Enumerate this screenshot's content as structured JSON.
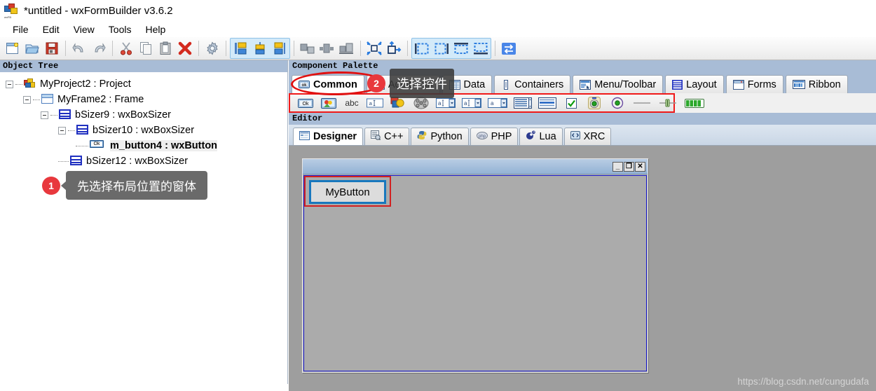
{
  "window": {
    "title": "*untitled - wxFormBuilder v3.6.2",
    "icon": "wxformbuilder-app-icon"
  },
  "menubar": {
    "items": [
      {
        "label": "File"
      },
      {
        "label": "Edit"
      },
      {
        "label": "View"
      },
      {
        "label": "Tools"
      },
      {
        "label": "Help"
      }
    ]
  },
  "toolbar": {
    "groups": [
      {
        "buttons": [
          {
            "name": "new-file-button",
            "icon": "new-document-icon"
          },
          {
            "name": "open-file-button",
            "icon": "open-folder-icon"
          },
          {
            "name": "save-file-button",
            "icon": "floppy-save-icon"
          }
        ]
      },
      {
        "buttons": [
          {
            "name": "undo-button",
            "icon": "undo-arrow-icon"
          },
          {
            "name": "redo-button",
            "icon": "redo-arrow-icon"
          }
        ]
      },
      {
        "buttons": [
          {
            "name": "cut-button",
            "icon": "scissors-icon"
          },
          {
            "name": "copy-button",
            "icon": "copy-icon"
          },
          {
            "name": "paste-button",
            "icon": "clipboard-paste-icon"
          },
          {
            "name": "delete-button",
            "icon": "red-x-delete-icon"
          }
        ]
      },
      {
        "buttons": [
          {
            "name": "generate-code-button",
            "icon": "gear-icon"
          }
        ]
      },
      {
        "buttons": [
          {
            "name": "align-left-button",
            "icon": "panel-left-icon"
          },
          {
            "name": "align-center-button",
            "icon": "panel-center-icon"
          },
          {
            "name": "align-right-button",
            "icon": "panel-right-icon"
          }
        ]
      },
      {
        "buttons": [
          {
            "name": "align-top-button",
            "icon": "align-top-icon"
          },
          {
            "name": "align-middle-button",
            "icon": "align-middle-icon"
          },
          {
            "name": "align-bottom-button",
            "icon": "align-bottom-icon"
          }
        ]
      },
      {
        "buttons": [
          {
            "name": "expand-button",
            "icon": "expand-arrows-icon"
          },
          {
            "name": "stretch-button",
            "icon": "stretch-arrow-icon"
          }
        ]
      },
      {
        "buttons": [
          {
            "name": "border-left-button",
            "icon": "border-left-icon"
          },
          {
            "name": "border-right-button",
            "icon": "border-right-icon"
          },
          {
            "name": "border-top-button",
            "icon": "border-top-icon"
          },
          {
            "name": "border-bottom-button",
            "icon": "border-bottom-icon"
          }
        ]
      },
      {
        "buttons": [
          {
            "name": "swap-orientation-button",
            "icon": "swap-arrows-icon"
          }
        ]
      }
    ]
  },
  "object_tree": {
    "header": "Object Tree",
    "nodes": [
      {
        "label": "MyProject2 : Project",
        "icon": "project-icon",
        "indent": 0,
        "expander": true,
        "selected": false
      },
      {
        "label": "MyFrame2 : Frame",
        "icon": "frame-icon",
        "indent": 1,
        "expander": true,
        "selected": false
      },
      {
        "label": "bSizer9 : wxBoxSizer",
        "icon": "sizer-icon",
        "indent": 2,
        "expander": true,
        "selected": false
      },
      {
        "label": "bSizer10 : wxBoxSizer",
        "icon": "sizer-icon",
        "indent": 3,
        "expander": true,
        "selected": false
      },
      {
        "label": "m_button4 : wxButton",
        "icon": "button-icon",
        "indent": 4,
        "expander": false,
        "selected": true
      },
      {
        "label": "bSizer12 : wxBoxSizer",
        "icon": "sizer-icon",
        "indent": 3,
        "expander": false,
        "selected": false
      }
    ]
  },
  "callouts": [
    {
      "number": "1",
      "text": "先选择布局位置的窗体"
    },
    {
      "number": "2",
      "text": "选择控件"
    }
  ],
  "component_palette": {
    "header": "Component Palette",
    "tabs": [
      {
        "label": "Common",
        "icon": "button-small-icon",
        "active": true
      },
      {
        "label": "Additional",
        "icon": "additional-icon",
        "active": false
      },
      {
        "label": "Data",
        "icon": "grid-data-icon",
        "active": false
      },
      {
        "label": "Containers",
        "icon": "container-icon",
        "active": false
      },
      {
        "label": "Menu/Toolbar",
        "icon": "menu-toolbar-icon",
        "active": false
      },
      {
        "label": "Layout",
        "icon": "layout-sizer-icon",
        "active": false
      },
      {
        "label": "Forms",
        "icon": "form-window-icon",
        "active": false
      },
      {
        "label": "Ribbon",
        "icon": "ribbon-icon",
        "active": false
      }
    ],
    "items": [
      {
        "name": "wxButton",
        "icon": "ok-button-icon"
      },
      {
        "name": "wxBitmapButton",
        "icon": "bitmap-button-icon"
      },
      {
        "name": "wxStaticText",
        "icon": "abc-statictext-icon"
      },
      {
        "name": "wxTextCtrl",
        "icon": "textctrl-icon"
      },
      {
        "name": "wxStaticBitmap",
        "icon": "static-bitmap-icon"
      },
      {
        "name": "wxAnimationCtrl",
        "icon": "film-reel-icon"
      },
      {
        "name": "wxComboBox",
        "icon": "combobox-icon"
      },
      {
        "name": "wxChoice",
        "icon": "choice-icon"
      },
      {
        "name": "wxBitmapCombo",
        "icon": "bitmap-combo-icon"
      },
      {
        "name": "wxListBox",
        "icon": "listbox-icon"
      },
      {
        "name": "wxCheckListBox",
        "icon": "checklistbox-icon"
      },
      {
        "name": "wxCheckBox",
        "icon": "checkbox-icon"
      },
      {
        "name": "wxRadioButton",
        "icon": "radiobutton-sel-icon"
      },
      {
        "name": "wxToggleButton",
        "icon": "radiobutton-icon"
      },
      {
        "name": "wxStaticLine",
        "icon": "staticline-icon"
      },
      {
        "name": "wxSlider",
        "icon": "slider-icon"
      },
      {
        "name": "wxGauge",
        "icon": "gauge-icon"
      }
    ],
    "highlight_color": "#f01a1a"
  },
  "editor": {
    "header": "Editor",
    "tabs": [
      {
        "label": "Designer",
        "icon": "designer-icon",
        "active": true
      },
      {
        "label": "C++",
        "icon": "cpp-icon",
        "active": false
      },
      {
        "label": "Python",
        "icon": "python-icon",
        "active": false
      },
      {
        "label": "PHP",
        "icon": "php-icon",
        "active": false
      },
      {
        "label": "Lua",
        "icon": "lua-icon",
        "active": false
      },
      {
        "label": "XRC",
        "icon": "xrc-icon",
        "active": false
      }
    ]
  },
  "designer": {
    "form": {
      "title": "",
      "window_buttons": [
        {
          "name": "minimize-button",
          "glyph": "_"
        },
        {
          "name": "maximize-button",
          "glyph": "❐"
        },
        {
          "name": "close-button",
          "glyph": "✕"
        }
      ],
      "button": {
        "label": "MyButton",
        "selection_border_color": "#d22020",
        "focus_border_color": "#1878be"
      }
    },
    "watermark": "https://blog.csdn.net/cungudafa"
  }
}
